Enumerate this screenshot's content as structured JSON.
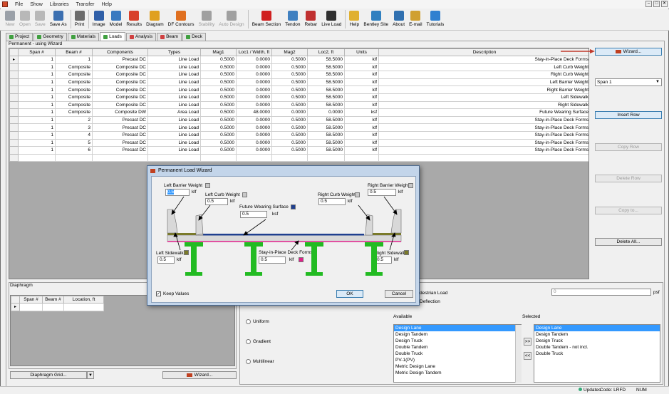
{
  "menu": [
    "File",
    "Show",
    "Libraries",
    "Transfer",
    "Help"
  ],
  "window_controls": [
    "–",
    "□",
    "✕"
  ],
  "toolbar": [
    {
      "label": "New",
      "icon": "new-icon",
      "color": "#9aa0a8",
      "disabled": true
    },
    {
      "label": "Open",
      "icon": "open-icon",
      "color": "#b8b8b8",
      "disabled": true
    },
    {
      "label": "Save",
      "icon": "save-icon",
      "color": "#b8b8b8",
      "disabled": true
    },
    {
      "label": "Save As",
      "icon": "save-as-icon",
      "color": "#3b6fb0",
      "disabled": false
    },
    {
      "label": "Print",
      "icon": "print-icon",
      "color": "#6b6b6b",
      "disabled": false
    },
    {
      "label": "Image",
      "icon": "image-icon",
      "color": "#2f5fa8",
      "disabled": false
    },
    {
      "label": "Model",
      "icon": "model-icon",
      "color": "#3a7ac0",
      "disabled": false
    },
    {
      "label": "Results",
      "icon": "results-icon",
      "color": "#d8402a",
      "disabled": false
    },
    {
      "label": "Diagram",
      "icon": "diagram-icon",
      "color": "#e0a020",
      "disabled": false
    },
    {
      "label": "DF Contours",
      "icon": "contours-icon",
      "color": "#e07020",
      "disabled": false
    },
    {
      "label": "Stability",
      "icon": "stability-icon",
      "color": "#a0a0a0",
      "disabled": true
    },
    {
      "label": "Auto Design",
      "icon": "auto-design-icon",
      "color": "#a0a0a0",
      "disabled": true
    },
    {
      "label": "Beam Section",
      "icon": "beam-section-icon",
      "color": "#d02020",
      "disabled": false
    },
    {
      "label": "Tendon",
      "icon": "tendon-icon",
      "color": "#4080c0",
      "disabled": false
    },
    {
      "label": "Rebar",
      "icon": "rebar-icon",
      "color": "#c03030",
      "disabled": false
    },
    {
      "label": "Live Load",
      "icon": "truck-icon",
      "color": "#303030",
      "disabled": false
    },
    {
      "label": "Help",
      "icon": "help-icon",
      "color": "#e0b030",
      "disabled": false
    },
    {
      "label": "Bentley Site",
      "icon": "globe-icon",
      "color": "#3080c0",
      "disabled": false
    },
    {
      "label": "About",
      "icon": "about-icon",
      "color": "#3070b0",
      "disabled": false
    },
    {
      "label": "E-mail",
      "icon": "email-icon",
      "color": "#d0a030",
      "disabled": false
    },
    {
      "label": "Tutorials",
      "icon": "tutorials-icon",
      "color": "#3080d0",
      "disabled": false
    }
  ],
  "tabs": [
    {
      "label": "Project",
      "color": "#40a040",
      "active": false
    },
    {
      "label": "Geometry",
      "color": "#40a040",
      "active": false
    },
    {
      "label": "Materials",
      "color": "#40a040",
      "active": false
    },
    {
      "label": "Loads",
      "color": "#40a040",
      "active": true
    },
    {
      "label": "Analysis",
      "color": "#d04040",
      "active": false
    },
    {
      "label": "Beam",
      "color": "#d04040",
      "active": false
    },
    {
      "label": "Deck",
      "color": "#40a040",
      "active": false
    }
  ],
  "permanent_label": "Permanent - using Wizard",
  "loads_table": {
    "columns": [
      "Span #",
      "Beam #",
      "Components",
      "Types",
      "Mag1",
      "Loc1 / Width, ft",
      "Mag2",
      "Loc2, ft",
      "Units",
      "Description"
    ],
    "rows": [
      [
        "1",
        "1",
        "Precast DC",
        "Line Load",
        "0.5000",
        "0.0000",
        "0.5000",
        "58.5000",
        "klf",
        "Stay-in-Place Deck Forms"
      ],
      [
        "1",
        "Composite",
        "Composite DC",
        "Line Load",
        "0.5000",
        "0.0000",
        "0.5000",
        "58.5000",
        "klf",
        "Left Curb Weight"
      ],
      [
        "1",
        "Composite",
        "Composite DC",
        "Line Load",
        "0.5000",
        "0.0000",
        "0.5000",
        "58.5000",
        "klf",
        "Right Curb Weight"
      ],
      [
        "1",
        "Composite",
        "Composite DC",
        "Line Load",
        "0.5000",
        "0.0000",
        "0.5000",
        "58.5000",
        "klf",
        "Left Barrier Weight"
      ],
      [
        "1",
        "Composite",
        "Composite DC",
        "Line Load",
        "0.5000",
        "0.0000",
        "0.5000",
        "58.5000",
        "klf",
        "Right Barrier Weight"
      ],
      [
        "1",
        "Composite",
        "Composite DC",
        "Line Load",
        "0.5000",
        "0.0000",
        "0.5000",
        "58.5000",
        "klf",
        "Left Sidewalk"
      ],
      [
        "1",
        "Composite",
        "Composite DC",
        "Line Load",
        "0.5000",
        "0.0000",
        "0.5000",
        "58.5000",
        "klf",
        "Right Sidewalk"
      ],
      [
        "1",
        "Composite",
        "Composite DW",
        "Area Load",
        "0.5000",
        "48.0000",
        "0.0000",
        "0.0000",
        "ksf",
        "Future Wearing Surface"
      ],
      [
        "1",
        "2",
        "Precast DC",
        "Line Load",
        "0.5000",
        "0.0000",
        "0.5000",
        "58.5000",
        "klf",
        "Stay-in-Place Deck Forms"
      ],
      [
        "1",
        "3",
        "Precast DC",
        "Line Load",
        "0.5000",
        "0.0000",
        "0.5000",
        "58.5000",
        "klf",
        "Stay-in-Place Deck Forms"
      ],
      [
        "1",
        "4",
        "Precast DC",
        "Line Load",
        "0.5000",
        "0.0000",
        "0.5000",
        "58.5000",
        "klf",
        "Stay-in-Place Deck Forms"
      ],
      [
        "1",
        "5",
        "Precast DC",
        "Line Load",
        "0.5000",
        "0.0000",
        "0.5000",
        "58.5000",
        "klf",
        "Stay-in-Place Deck Forms"
      ],
      [
        "1",
        "6",
        "Precast DC",
        "Line Load",
        "0.5000",
        "0.0000",
        "0.5000",
        "58.5000",
        "klf",
        "Stay-in-Place Deck Forms"
      ]
    ]
  },
  "side_buttons": {
    "wizard": "Wizard...",
    "span_select": "Span 1",
    "insert_row": "Insert Row",
    "copy_row": "Copy Row",
    "delete_row": "Delete Row",
    "copy_to": "Copy to...",
    "delete_all": "Delete All..."
  },
  "wizard_dialog": {
    "title": "Permanent Load Wizard",
    "left_barrier": {
      "label": "Left Barrier Weight",
      "value": "0.5",
      "unit": "klf"
    },
    "left_curb": {
      "label": "Left Curb Weight",
      "value": "0.5",
      "unit": "klf"
    },
    "fws": {
      "label": "Future Wearing Surface",
      "value": "0.5",
      "unit": "ksf"
    },
    "right_curb": {
      "label": "Right Curb Weight",
      "value": "0.5",
      "unit": "klf"
    },
    "right_barrier": {
      "label": "Right Barrier Weight",
      "value": "0.5",
      "unit": "klf"
    },
    "left_sidewalk": {
      "label": "Left Sidewalk",
      "value": "0.5",
      "unit": "klf"
    },
    "sip_forms": {
      "label": "Stay-in-Place Deck Forms",
      "value": "0.5",
      "unit": "klf"
    },
    "right_sidewalk": {
      "label": "Right Sidewalk",
      "value": "0.5",
      "unit": "klf"
    },
    "keep_values": "Keep Values",
    "ok": "OK",
    "cancel": "Cancel",
    "colors": {
      "fws": "#1f3f8f",
      "sip": "#e0208a",
      "sidewalk": "#7a7a2a",
      "swatch_grey": "#c8c8c8",
      "girder": "#22bb22",
      "deck": "#d8d8d8"
    }
  },
  "diaphragm": {
    "label": "Diaphragm",
    "columns": [
      "Span #",
      "Beam #",
      "Location, ft"
    ],
    "grid_button": "Diaphragm Grid...",
    "wizard_button": "Wizard..."
  },
  "live_load": {
    "pedestrian_label": "destrian Load",
    "deflection_label": "Deflection",
    "pedestrian_value": "0",
    "pedestrian_unit": "psf",
    "radios": [
      "Uniform",
      "Gradient",
      "Multilinear"
    ],
    "available_label": "Available",
    "selected_label": "Selected",
    "available": [
      "Design Lane",
      "Design Tandem",
      "Design Truck",
      "Double Tandem",
      "Double Truck",
      "PV-1(PV)",
      "Metric Design Lane",
      "Metric Design Tandem"
    ],
    "selected": [
      "Design Lane",
      "Design Tandem",
      "Design Truck",
      "Double Tandem - not incl.",
      "Double Truck"
    ],
    "add": ">>",
    "remove": "<<"
  },
  "status": {
    "updates": "Updates",
    "code": "Code: LRFD",
    "num": "NUM"
  }
}
